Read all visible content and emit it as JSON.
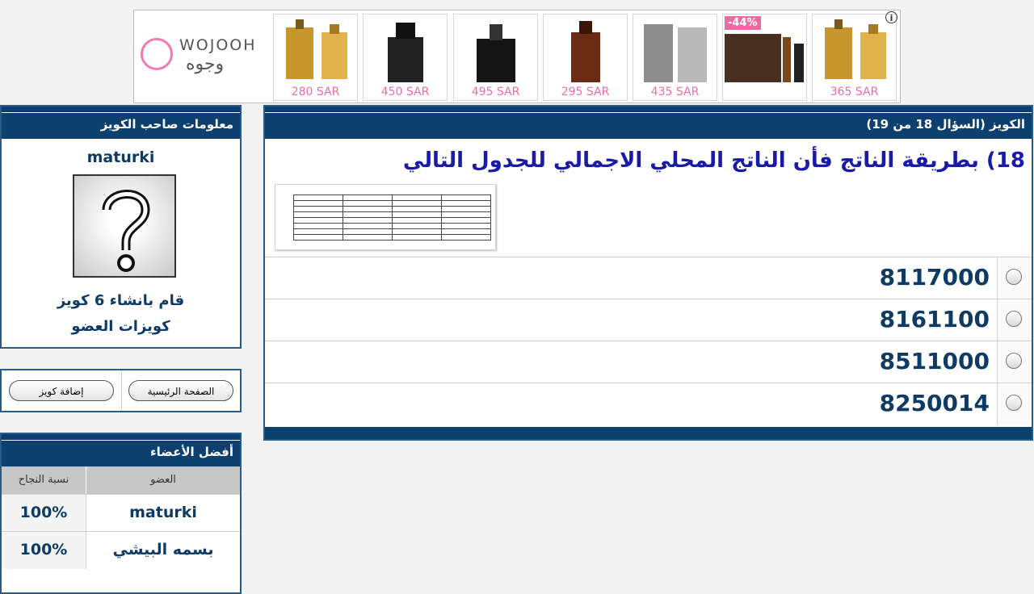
{
  "ad": {
    "brand_en": "WOJOOH",
    "brand_ar": "وجوه",
    "info": "i",
    "products": [
      {
        "price": "280 SAR",
        "badge": ""
      },
      {
        "price": "450 SAR",
        "badge": ""
      },
      {
        "price": "495 SAR",
        "badge": ""
      },
      {
        "price": "295 SAR",
        "badge": ""
      },
      {
        "price": "435 SAR",
        "badge": ""
      },
      {
        "price": "",
        "badge": "-44%"
      },
      {
        "price": "365 SAR",
        "badge": ""
      }
    ]
  },
  "quiz": {
    "header": "الكويز (السؤال 18 من 19)",
    "question": "18) بطريقة الناتج فأن الناتج المحلي الاجمالي للجدول التالي",
    "answers": [
      "8117000",
      "8161100",
      "8511000",
      "8250014"
    ]
  },
  "owner": {
    "header": "معلومات صاحب الكويز",
    "username": "maturki",
    "created": "قام بانشاء 6 كويز",
    "quizzes_link": "كويزات العضو"
  },
  "buttons": {
    "home": "الصفحة الرئيسية",
    "add_quiz": "إضافة كويز"
  },
  "top_members": {
    "header": "أفضل الأعضاء",
    "col_member": "العضو",
    "col_rate": "نسبة النجاح",
    "rows": [
      {
        "name": "maturki",
        "rate": "100%"
      },
      {
        "name": "بسمه البيشي",
        "rate": "100%"
      }
    ]
  }
}
